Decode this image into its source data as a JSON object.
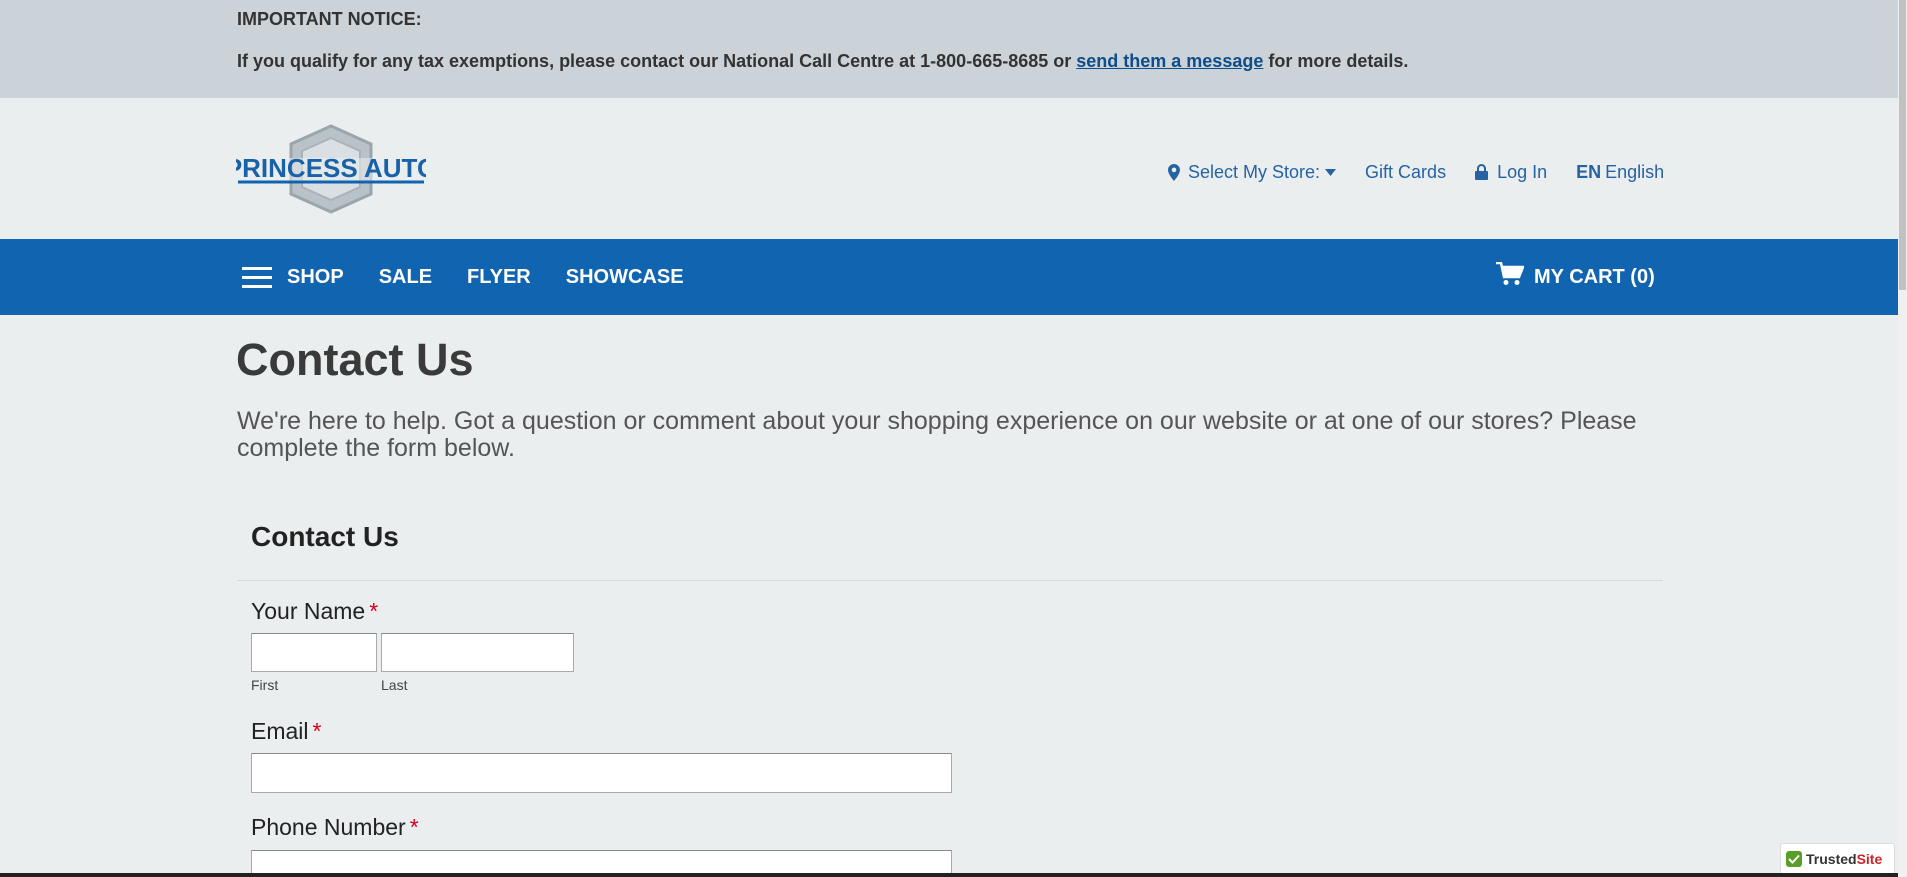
{
  "notice": {
    "title": "IMPORTANT NOTICE:",
    "text_before": "If you qualify for any tax exemptions, please contact our National Call Centre at 1-800-665-8685 or ",
    "link": "send them a message",
    "text_after": " for more details."
  },
  "logo": {
    "text": "PRINCESS AUTO"
  },
  "utility_nav": {
    "store": "Select My Store:",
    "gift_cards": "Gift Cards",
    "login": "Log In",
    "lang_code": "EN",
    "lang_name": "English"
  },
  "main_nav": {
    "shop": "SHOP",
    "sale": "SALE",
    "flyer": "FLYER",
    "showcase": "SHOWCASE",
    "cart": "MY CART (0)"
  },
  "page": {
    "title": "Contact Us",
    "intro": "We're here to help. Got a question or comment about your shopping experience on our website or at one of our stores? Please complete the form below."
  },
  "form": {
    "heading": "Contact Us",
    "name_label": "Your Name",
    "required_mark": "*",
    "first_label": "First",
    "last_label": "Last",
    "first_value": "",
    "last_value": "",
    "email_label": "Email",
    "email_value": "",
    "phone_label": "Phone Number",
    "phone_value": ""
  },
  "badge": {
    "trusted": "Trusted",
    "site": "Site"
  },
  "colors": {
    "brand_blue": "#1164b0",
    "notice_bg": "#cbd3d8",
    "page_bg": "#ebeeef",
    "required": "#d0021b"
  }
}
